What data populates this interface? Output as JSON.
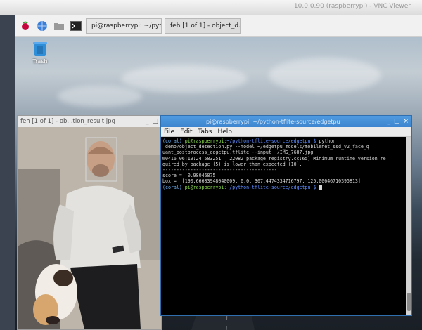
{
  "vnc": {
    "title": "10.0.0.90 (raspberrypi) - VNC Viewer"
  },
  "taskbar": {
    "tasks": [
      {
        "label": "pi@raspberrypi: ~/pyt..."
      },
      {
        "label": "feh [1 of 1] - object_d..."
      }
    ]
  },
  "desktop": {
    "trash_label": "Trash"
  },
  "feh_window": {
    "title": "feh [1 of 1] - ob...tion_result.jpg"
  },
  "terminal": {
    "title": "pi@raspberrypi: ~/python-tflite-source/edgetpu",
    "menu": [
      "File",
      "Edit",
      "Tabs",
      "Help"
    ],
    "prompt_env": "(coral)",
    "prompt_user": "pi@raspberrypi",
    "prompt_path": ":~/python-tflite-source/edgetpu $",
    "command": " python demo/object_detection.py --model ~/edgetpu_models/mobilenet_ssd_v2_face_quant_postprocess_edgetpu.tflite --input ~/IMG_7687.jpg",
    "lines": [
      "W0416 06:19:24.583251   22082 package_registry.cc:65] Minimum runtime version re",
      "quired by package (5) is lower than expected (10).",
      "-----------------------------------------",
      "score =  0.98046875",
      "box =  [190.66683948040009, 0.0, 307.4474334716797, 125.00646710395813]"
    ]
  }
}
